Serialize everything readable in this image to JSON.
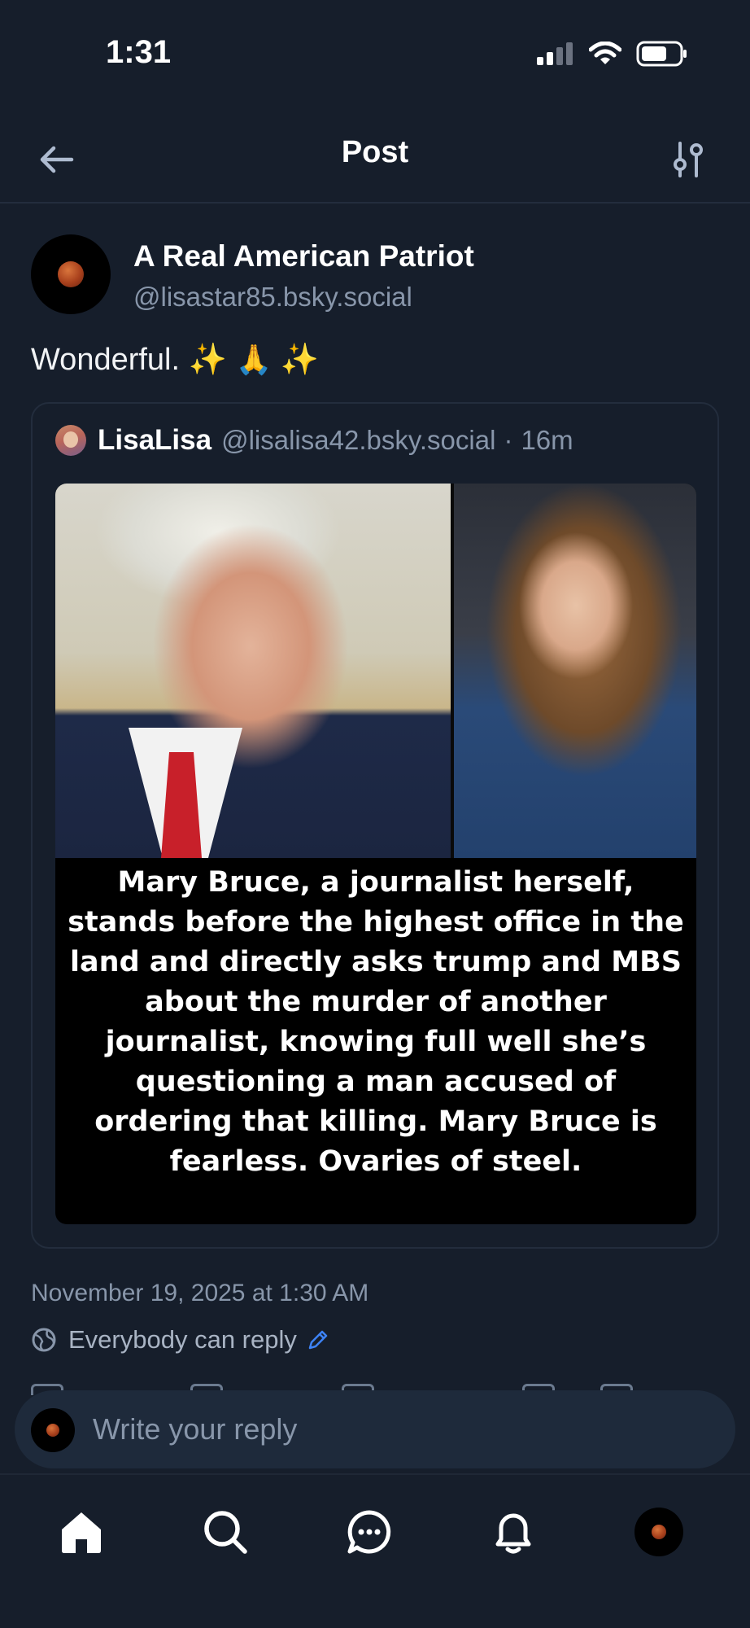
{
  "status_bar": {
    "time": "1:31",
    "icons": [
      "cellular-signal-icon",
      "wifi-icon",
      "battery-icon"
    ]
  },
  "header": {
    "title": "Post",
    "back_icon": "arrow-left-icon",
    "filter_icon": "sliders-icon"
  },
  "post": {
    "author_name": "A Real American Patriot",
    "author_handle": "@lisastar85.bsky.social",
    "text": "Wonderful.",
    "emoji": [
      "✨",
      "🙏",
      "✨"
    ],
    "timestamp": "November 19, 2025 at 1:30 AM",
    "reply_setting": "Everybody can reply"
  },
  "quote": {
    "author_name": "LisaLisa",
    "author_handle": "@lisalisa42.bsky.social",
    "separator": "·",
    "time": "16m",
    "caption": "Mary Bruce, a journalist herself, stands before the highest office in the land and directly asks trump and MBS about the murder of another journalist, knowing full well she’s questioning a man accused of ordering that killing. Mary Bruce is fearless. Ovaries of steel."
  },
  "reply_bar": {
    "placeholder": "Write your reply"
  },
  "tabbar": {
    "items": [
      "home-icon",
      "search-icon",
      "chat-icon",
      "bell-icon",
      "profile-avatar"
    ]
  },
  "colors": {
    "background": "#161e2b",
    "text_primary": "#f1f3f5",
    "text_secondary": "#8896aa",
    "accent": "#3d83f6"
  }
}
